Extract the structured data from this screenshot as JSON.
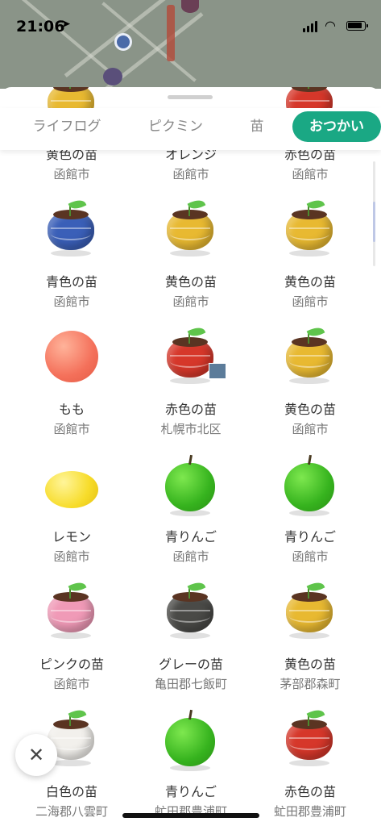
{
  "status": {
    "time": "21:06",
    "location_icon": "location-arrow-icon",
    "signal_icon": "signal-icon",
    "wifi_icon": "wifi-icon",
    "battery_icon": "battery-icon"
  },
  "tabs": [
    {
      "label": "ライフログ",
      "active": false
    },
    {
      "label": "ピクミン",
      "active": false
    },
    {
      "label": "苗",
      "active": false
    },
    {
      "label": "おつかい",
      "active": true
    }
  ],
  "accent_color": "#1aa884",
  "rows": [
    [
      {
        "name": "黄色の苗",
        "place": "函館市",
        "type": "pot",
        "color": "#e8b931"
      },
      {
        "name": "オレンジ",
        "place": "函館市",
        "type": "fruit-orange"
      },
      {
        "name": "赤色の苗",
        "place": "函館市",
        "type": "pot",
        "color": "#d6372a"
      }
    ],
    [
      {
        "name": "青色の苗",
        "place": "函館市",
        "type": "pot",
        "color": "#3a5fb8"
      },
      {
        "name": "黄色の苗",
        "place": "函館市",
        "type": "pot",
        "color": "#e8b931"
      },
      {
        "name": "黄色の苗",
        "place": "函館市",
        "type": "pot",
        "color": "#e8b931"
      }
    ],
    [
      {
        "name": "もも",
        "place": "函館市",
        "type": "peach"
      },
      {
        "name": "赤色の苗",
        "place": "札幌市北区",
        "type": "pot",
        "color": "#d6372a",
        "badge": true
      },
      {
        "name": "黄色の苗",
        "place": "函館市",
        "type": "pot",
        "color": "#e8b931"
      }
    ],
    [
      {
        "name": "レモン",
        "place": "函館市",
        "type": "lemon"
      },
      {
        "name": "青りんご",
        "place": "函館市",
        "type": "apple"
      },
      {
        "name": "青りんご",
        "place": "函館市",
        "type": "apple"
      }
    ],
    [
      {
        "name": "ピンクの苗",
        "place": "函館市",
        "type": "pot",
        "color": "#f09ab7"
      },
      {
        "name": "グレーの苗",
        "place": "亀田郡七飯町",
        "type": "pot",
        "color": "#4a4a47"
      },
      {
        "name": "黄色の苗",
        "place": "茅部郡森町",
        "type": "pot",
        "color": "#e8b931"
      }
    ],
    [
      {
        "name": "白色の苗",
        "place": "二海郡八雲町",
        "type": "pot",
        "color": "#f2f0ec"
      },
      {
        "name": "青りんご",
        "place": "虻田郡豊浦町",
        "type": "apple"
      },
      {
        "name": "赤色の苗",
        "place": "虻田郡豊浦町",
        "type": "pot",
        "color": "#d6372a"
      }
    ]
  ],
  "close_icon": "close-icon"
}
